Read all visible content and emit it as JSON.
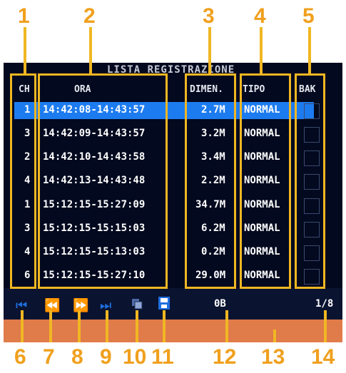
{
  "title": "LISTA REGISTRAZIONE",
  "headers": {
    "ch": "CH",
    "ora": "ORA",
    "dimen": "DIMEN.",
    "tipo": "TIPO",
    "bak": "BAK"
  },
  "rows": [
    {
      "ch": "1",
      "ora": "14:42:08-14:43:57",
      "dimen": "2.7M",
      "tipo": "NORMAL"
    },
    {
      "ch": "3",
      "ora": "14:42:09-14:43:57",
      "dimen": "3.2M",
      "tipo": "NORMAL"
    },
    {
      "ch": "2",
      "ora": "14:42:10-14:43:58",
      "dimen": "3.4M",
      "tipo": "NORMAL"
    },
    {
      "ch": "4",
      "ora": "14:42:13-14:43:48",
      "dimen": "2.2M",
      "tipo": "NORMAL"
    },
    {
      "ch": "1",
      "ora": "15:12:15-15:27:09",
      "dimen": "34.7M",
      "tipo": "NORMAL"
    },
    {
      "ch": "3",
      "ora": "15:12:15-15:15:03",
      "dimen": "6.2M",
      "tipo": "NORMAL"
    },
    {
      "ch": "4",
      "ora": "15:12:15-15:13:03",
      "dimen": "0.2M",
      "tipo": "NORMAL"
    },
    {
      "ch": "6",
      "ora": "15:12:15-15:27:10",
      "dimen": "29.0M",
      "tipo": "NORMAL"
    }
  ],
  "footer": {
    "size": "0B",
    "page": "1/8"
  },
  "callouts_top": [
    "1",
    "2",
    "3",
    "4",
    "5"
  ],
  "callouts_bottom": [
    "6",
    "7",
    "8",
    "9",
    "10",
    "11",
    "12",
    "13",
    "14"
  ],
  "colors": {
    "accent": "#f0b722",
    "screen": "#03091f",
    "selected_row": "#1d7bf0",
    "bottom_bar": "#e07b4a"
  },
  "icons": [
    "first-icon",
    "rewind-icon",
    "forward-icon",
    "last-icon",
    "copy-icon",
    "save-icon"
  ]
}
